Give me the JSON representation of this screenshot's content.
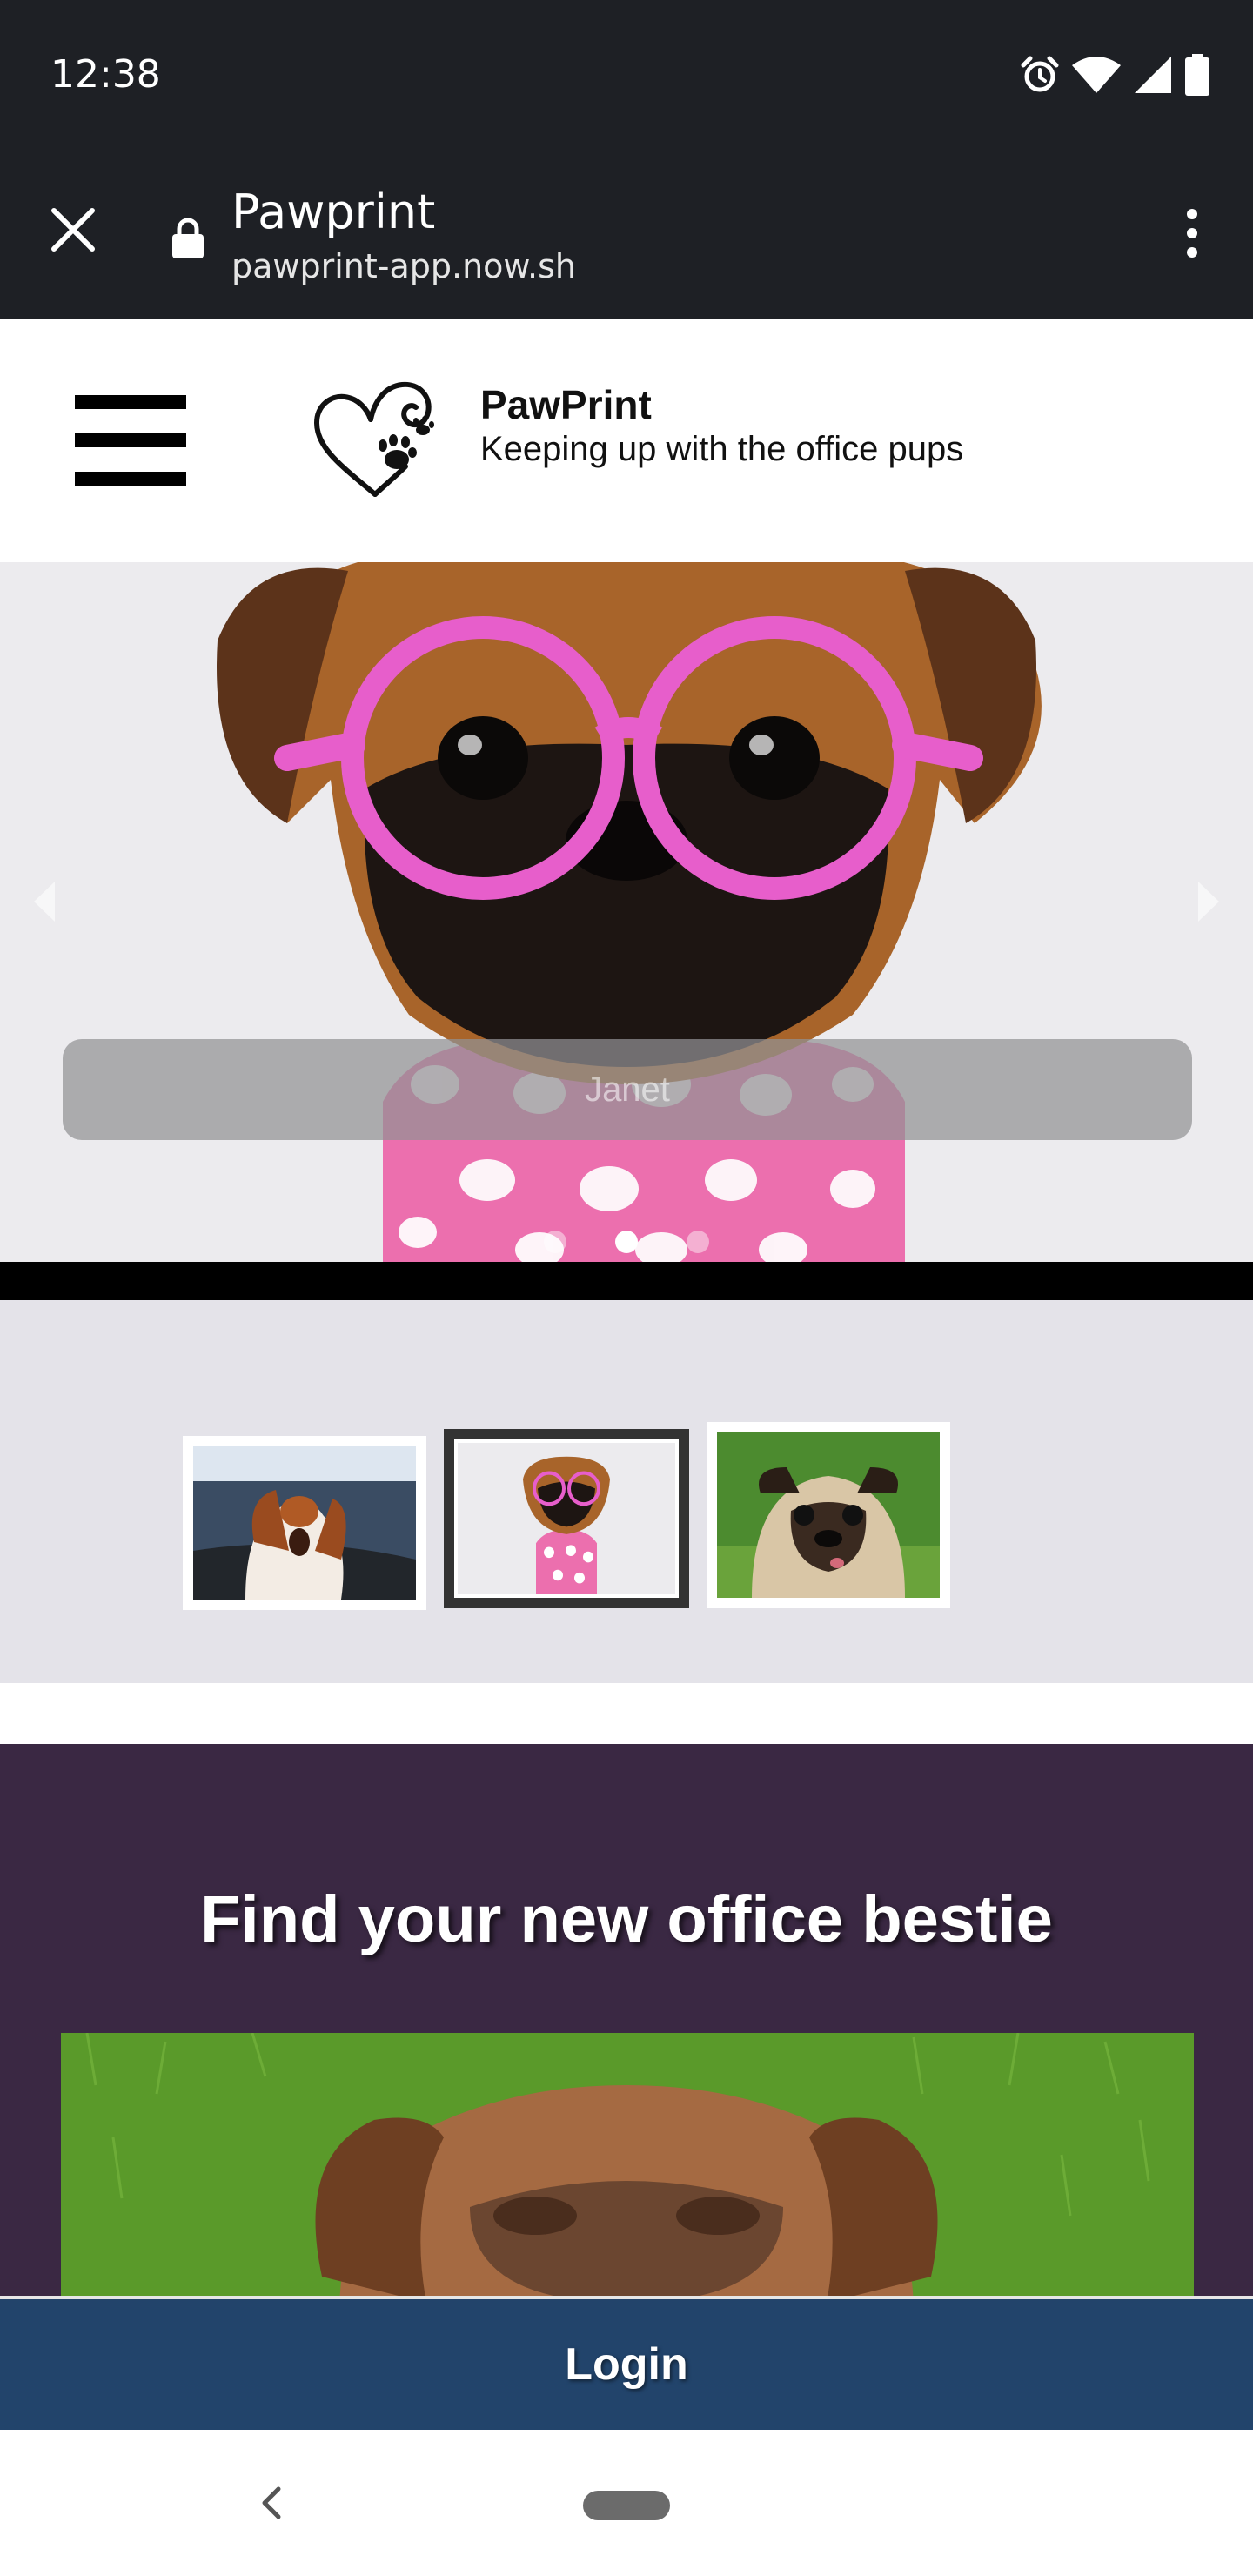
{
  "status_bar": {
    "time": "12:38",
    "icons": [
      "alarm-icon",
      "wifi-icon",
      "signal-icon",
      "battery-icon"
    ]
  },
  "browser": {
    "title": "Pawprint",
    "url": "pawprint-app.now.sh",
    "icons": [
      "close-icon",
      "lock-icon",
      "more-vert-icon"
    ]
  },
  "header": {
    "brand_name": "PawPrint",
    "tagline": "Keeping up with the office pups",
    "icons": [
      "hamburger-menu-icon",
      "heart-paw-logo"
    ]
  },
  "carousel": {
    "caption": "Janet",
    "slide_count": 3,
    "active_index": 1,
    "icons": [
      "chevron-left-icon",
      "chevron-right-icon"
    ]
  },
  "thumbnails": [
    {
      "name": "basset-hound",
      "selected": false
    },
    {
      "name": "janet",
      "selected": true
    },
    {
      "name": "pug",
      "selected": false
    }
  ],
  "promo": {
    "title": "Find your new office bestie"
  },
  "login": {
    "label": "Login"
  },
  "colors": {
    "status_bar": "#1e2025",
    "promo_bg": "#3a2843",
    "login_bg": "#22446b",
    "thumb_bg": "#e4e3e9",
    "caption_bg": "#919194"
  }
}
